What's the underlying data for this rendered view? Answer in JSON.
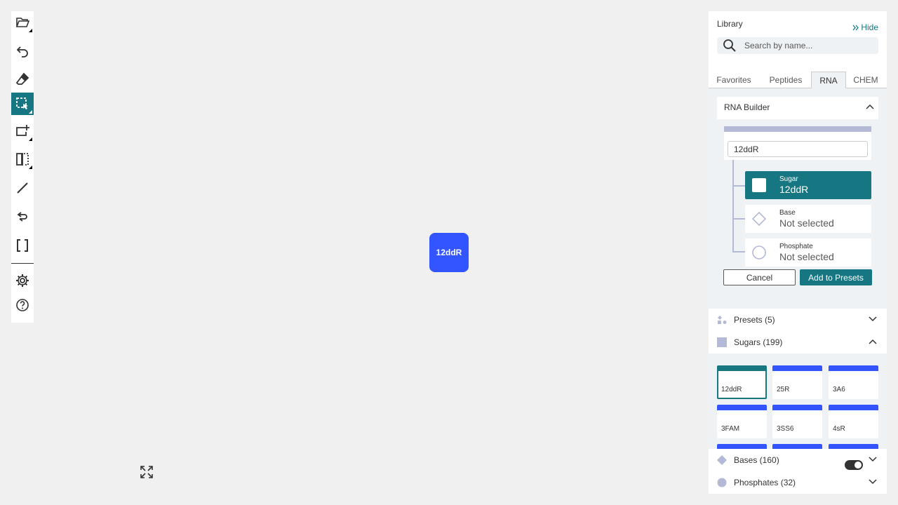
{
  "toolbar": {
    "tools": [
      {
        "name": "open-file-icon"
      },
      {
        "name": "undo-icon"
      },
      {
        "name": "eraser-icon"
      },
      {
        "name": "select-rectangle-icon",
        "active": true
      },
      {
        "name": "add-monomer-icon"
      },
      {
        "name": "flip-icon"
      },
      {
        "name": "single-bond-icon"
      },
      {
        "name": "curved-bond-icon"
      },
      {
        "name": "brackets-icon"
      },
      {
        "name": "settings-icon"
      },
      {
        "name": "help-icon"
      }
    ]
  },
  "canvas": {
    "monomer_label": "12ddR",
    "monomer_color": "#3355ff"
  },
  "library": {
    "title": "Library",
    "hide_label": "Hide",
    "search_placeholder": "Search by name...",
    "tabs": [
      {
        "label": "Favorites"
      },
      {
        "label": "Peptides"
      },
      {
        "label": "RNA",
        "active": true
      },
      {
        "label": "CHEM"
      }
    ],
    "rna_builder": {
      "title": "RNA Builder",
      "name_value": "12ddR",
      "components": [
        {
          "label": "Sugar",
          "value": "12ddR",
          "selected": true
        },
        {
          "label": "Base",
          "value": "Not selected"
        },
        {
          "label": "Phosphate",
          "value": "Not selected"
        }
      ],
      "cancel_label": "Cancel",
      "add_label": "Add to Presets"
    },
    "presets_label": "Presets (5)",
    "sugars_label": "Sugars (199)",
    "sugars": [
      "12ddR",
      "25R",
      "3A6",
      "3FAM",
      "3SS6",
      "4sR",
      "",
      "",
      ""
    ],
    "bases_label": "Bases (160)",
    "phosphates_label": "Phosphates (32)"
  },
  "colors": {
    "accent": "#167782",
    "monomer": "#3355ff",
    "panel_bg": "#eff2f5",
    "tree_line": "#b4b9d6"
  }
}
